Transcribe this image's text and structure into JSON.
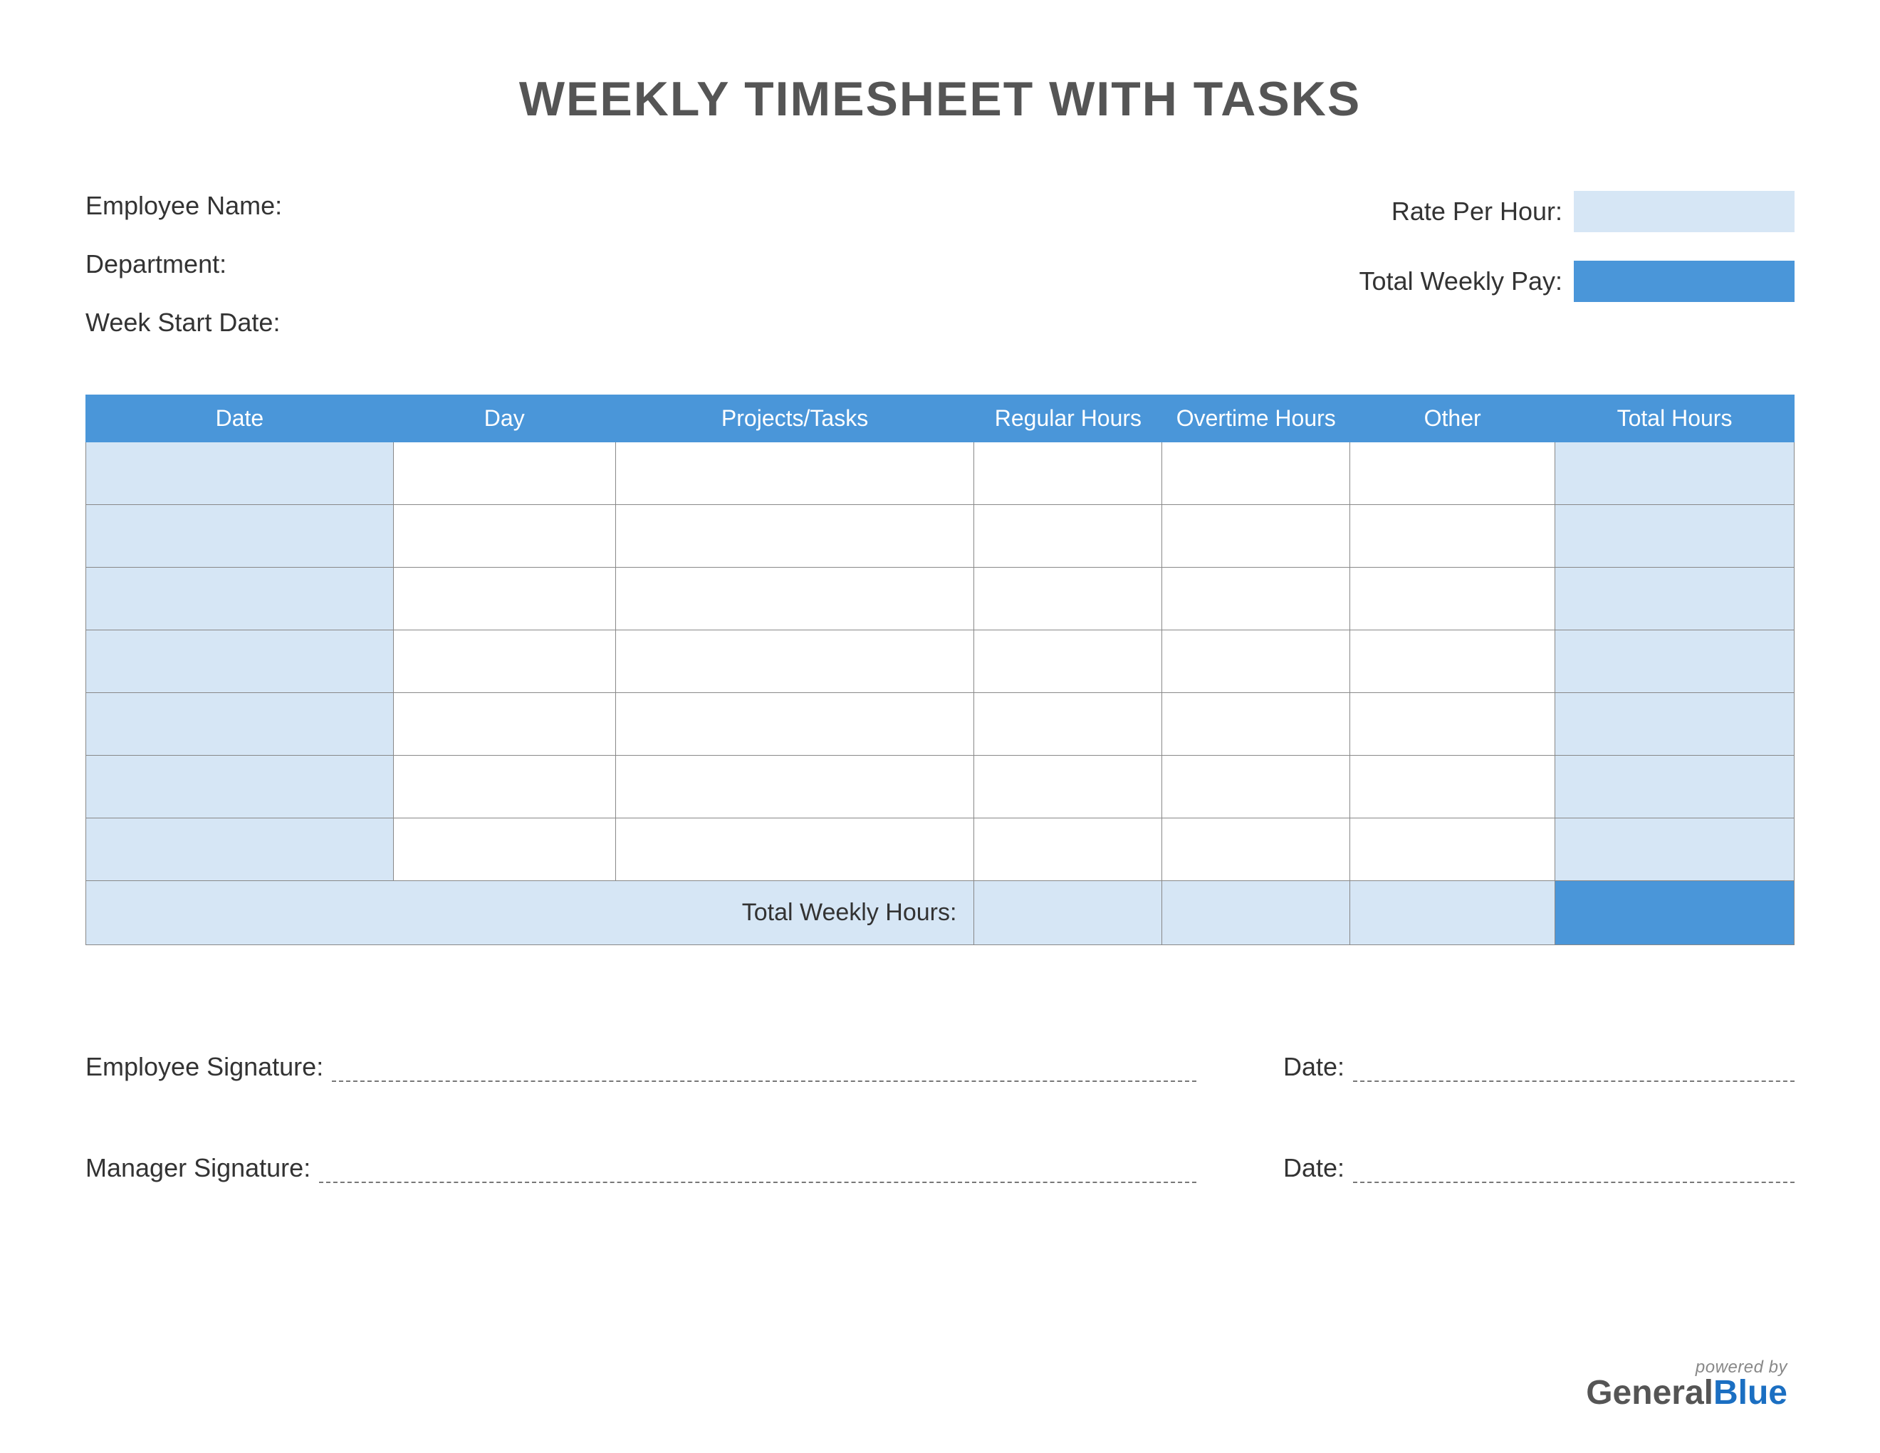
{
  "title": "WEEKLY TIMESHEET WITH TASKS",
  "labels": {
    "employee_name": "Employee Name:",
    "department": "Department:",
    "week_start": "Week Start Date:",
    "rate_per_hour": "Rate Per Hour:",
    "total_weekly_pay": "Total Weekly Pay:",
    "employee_signature": "Employee Signature:",
    "manager_signature": "Manager Signature:",
    "date": "Date:",
    "total_weekly_hours": "Total Weekly Hours:"
  },
  "values": {
    "employee_name": "",
    "department": "",
    "week_start": "",
    "rate_per_hour": "",
    "total_weekly_pay": ""
  },
  "table": {
    "headers": {
      "date": "Date",
      "day": "Day",
      "projects": "Projects/Tasks",
      "regular": "Regular Hours",
      "overtime": "Overtime Hours",
      "other": "Other",
      "total": "Total Hours"
    },
    "rows": [
      {
        "date": "",
        "day": "",
        "projects": "",
        "regular": "",
        "overtime": "",
        "other": "",
        "total": ""
      },
      {
        "date": "",
        "day": "",
        "projects": "",
        "regular": "",
        "overtime": "",
        "other": "",
        "total": ""
      },
      {
        "date": "",
        "day": "",
        "projects": "",
        "regular": "",
        "overtime": "",
        "other": "",
        "total": ""
      },
      {
        "date": "",
        "day": "",
        "projects": "",
        "regular": "",
        "overtime": "",
        "other": "",
        "total": ""
      },
      {
        "date": "",
        "day": "",
        "projects": "",
        "regular": "",
        "overtime": "",
        "other": "",
        "total": ""
      },
      {
        "date": "",
        "day": "",
        "projects": "",
        "regular": "",
        "overtime": "",
        "other": "",
        "total": ""
      },
      {
        "date": "",
        "day": "",
        "projects": "",
        "regular": "",
        "overtime": "",
        "other": "",
        "total": ""
      }
    ],
    "totals": {
      "regular": "",
      "overtime": "",
      "other": "",
      "total": ""
    }
  },
  "footer": {
    "prefix": "powered by",
    "brand1": "General",
    "brand2": "Blue"
  }
}
